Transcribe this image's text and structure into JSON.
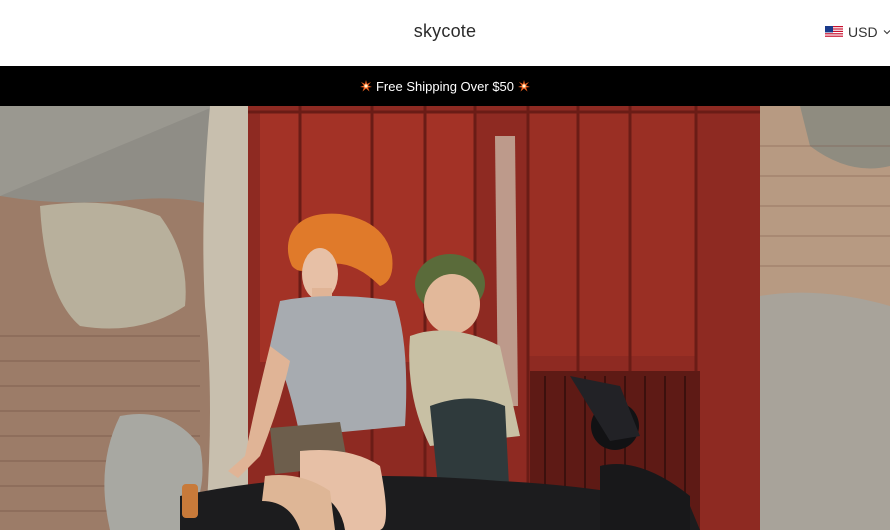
{
  "header": {
    "brand": "skycote",
    "currency": {
      "code": "USD",
      "flag_icon": "us-flag-icon"
    }
  },
  "announcement": {
    "text": "Free Shipping Over $50",
    "icon": "sparkle-burst-icon",
    "icon_color": "#f26522"
  },
  "hero": {
    "image_description": "Woman with red hair in grey t-shirt sitting on a motorcycle in front of a painted red wooden door with a street-art boy mural and a weathered brick wall"
  },
  "colors": {
    "announcement_bg": "#000000",
    "announcement_text": "#ffffff",
    "brand_text": "#2b2b2b"
  }
}
